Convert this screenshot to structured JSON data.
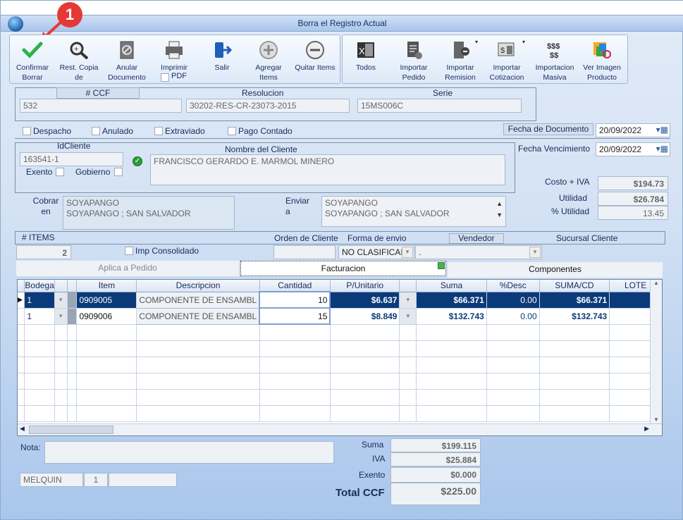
{
  "window": {
    "title": "Borra el Registro Actual"
  },
  "callout": {
    "number": "1"
  },
  "toolbar": {
    "confirm": "Confirmar Borrar",
    "rest_copia": "Rest. Copia de",
    "anular": "Anular Documento",
    "imprimir": "Imprimir",
    "pdf": "PDF",
    "salir": "Salir",
    "agregar": "Agregar Items",
    "quitar": "Quitar Items",
    "todos": "Todos",
    "imp_pedido": "Importar Pedido",
    "imp_remision": "Importar Remision",
    "imp_cotizacion": "Importar Cotizacion",
    "imp_masiva": "Importacion Masiva",
    "ver_imagen": "Ver Imagen Producto"
  },
  "doc": {
    "ccf_label": "# CCF",
    "ccf": "532",
    "resolucion_label": "Resolucion",
    "resolucion": "30202-RES-CR-23073-2015",
    "serie_label": "Serie",
    "serie": "15MS006C"
  },
  "flags": {
    "despacho": "Despacho",
    "anulado": "Anulado",
    "extraviado": "Extraviado",
    "pago_contado": "Pago Contado"
  },
  "fechas": {
    "doc_label": "Fecha de  Documento",
    "doc": "20/09/2022",
    "venc_label": "Fecha Vencimiento",
    "venc": "20/09/2022"
  },
  "cliente": {
    "id_label": "IdCliente",
    "id": "163541-1",
    "exento": "Exento",
    "gobierno": "Gobierno",
    "nombre_label": "Nombre del Cliente",
    "nombre": "FRANCISCO GERARDO E. MARMOL MINERO"
  },
  "costos": {
    "costo_label": "Costo + IVA",
    "costo": "$194.73",
    "utilidad_label": "Utilidad",
    "utilidad": "$26.784",
    "pct_label": "% Utilidad",
    "pct": "13.45"
  },
  "direcciones": {
    "cobrar_label": "Cobrar en",
    "cobrar_1": "SOYAPANGO",
    "cobrar_2": "SOYAPANGO ; SAN SALVADOR",
    "enviar_label": "Enviar a",
    "enviar_1": "SOYAPANGO",
    "enviar_2": "SOYAPANGO ; SAN SALVADOR"
  },
  "items_bar": {
    "items_label": "# ITEMS",
    "items": "2",
    "imp_consolidado": "Imp Consolidado",
    "orden_label": "Orden de Cliente",
    "forma_label": "Forma de envio",
    "forma": "NO CLASIFICAI",
    "vendedor_label": "Vendedor",
    "vendedor": ".",
    "sucursal_label": "Sucursal Cliente"
  },
  "tabs": {
    "aplica": "Aplica a Pedido",
    "facturacion": "Facturacion",
    "componentes": "Componentes"
  },
  "grid": {
    "columns": [
      "Bodega",
      "",
      "",
      "Item",
      "Descripcion",
      "Cantidad",
      "P/Unitario",
      "",
      "Suma",
      "%Desc",
      "SUMA/CD",
      "LOTE"
    ],
    "rows": [
      {
        "bodega": "1",
        "item": "0909005",
        "descripcion": "COMPONENTE DE ENSAMBL",
        "cantidad": "10",
        "punit": "$6.637",
        "suma": "$66.371",
        "desc": "0.00",
        "sumacd": "$66.371",
        "lote": ""
      },
      {
        "bodega": "1",
        "item": "0909006",
        "descripcion": "COMPONENTE DE ENSAMBL",
        "cantidad": "15",
        "punit": "$8.849",
        "suma": "$132.743",
        "desc": "0.00",
        "sumacd": "$132.743",
        "lote": ""
      }
    ]
  },
  "footer": {
    "nota_label": "Nota:",
    "user": "MELQUIN",
    "user_num": "1",
    "suma_label": "Suma",
    "suma": "$199.115",
    "iva_label": "IVA",
    "iva": "$25.884",
    "exento_label": "Exento",
    "exento": "$0.000",
    "total_label": "Total CCF",
    "total": "$225.00"
  },
  "colors": {
    "accent": "#0b3a7a",
    "callout": "#e53935",
    "confirm": "#2bb24a"
  }
}
